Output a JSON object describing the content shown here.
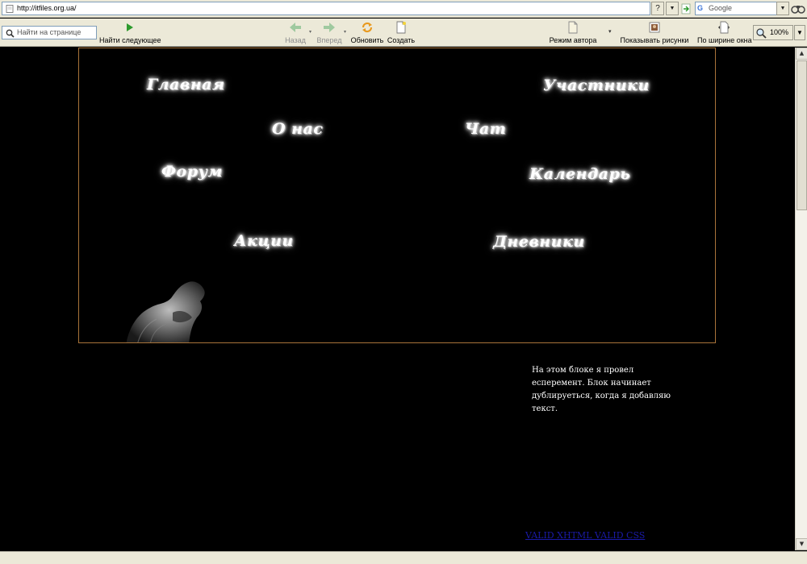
{
  "browser": {
    "address": "http://itfiles.org.ua/",
    "help_label": "?",
    "dropdown_glyph": "▼",
    "search_engine": "Google",
    "find_placeholder": "Найти на странице",
    "find_next_label": "Найти следующее",
    "back_label": "Назад",
    "forward_label": "Вперед",
    "refresh_label": "Обновить",
    "create_label": "Создать",
    "author_mode_label": "Режим автора",
    "show_images_label": "Показывать рисунки",
    "fit_width_label": "По ширине окна",
    "zoom_value": "100%"
  },
  "page": {
    "nav": {
      "home": "Главная",
      "members": "Участники",
      "about": "О нас",
      "chat": "Чат",
      "forum": "Форум",
      "calendar": "Календарь",
      "promotions": "Акции",
      "diaries": "Дневники"
    },
    "note_text": "На этом блоке я провел есперемент. Блок начинает дублируеться, когда я добавляю текст.",
    "valid_link": "VALID XHTML VALID CSS"
  },
  "colors": {
    "background": "#000000",
    "banner_border": "#a9743a",
    "link": "#1a1aa6"
  }
}
